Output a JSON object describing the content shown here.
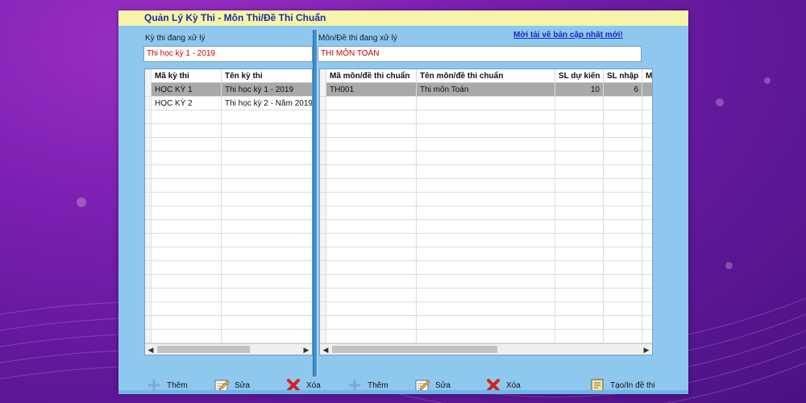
{
  "window": {
    "title": "Quản Lý Kỳ Thi - Môn Thi/Đề Thi Chuẩn"
  },
  "left": {
    "label": "Kỳ thi đang xử lý",
    "value": "Thi học kỳ 1 - 2019",
    "columns": [
      "Mã kỳ thi",
      "Tên kỳ thi"
    ],
    "rows": [
      [
        "HỌC KỲ 1",
        "Thi học kỳ 1 - 2019"
      ],
      [
        "HỌC KỲ 2",
        "Thi học kỳ 2 - Năm 2019"
      ]
    ],
    "selected_row": 0
  },
  "right": {
    "label": "Môn/Đề thi đang xử lý",
    "value": "THI MÔN TOÁN",
    "update_link": "Mời tải về bản cập nhật mới!",
    "columns": [
      "Mã môn/đề thi chuẩn",
      "Tên môn/đề thi chuẩn",
      "SL dự kiến",
      "SL nhập",
      "M"
    ],
    "rows": [
      [
        "TH001",
        "Thi môn Toán",
        "10",
        "6",
        ""
      ]
    ],
    "selected_row": 0
  },
  "toolbar": {
    "add_label": "Thêm",
    "edit_label": "Sửa",
    "delete_label": "Xóa",
    "add2_label": "Thêm",
    "edit2_label": "Sửa",
    "delete2_label": "Xóa",
    "create_label": "Tạo/In đề thi"
  },
  "colors": {
    "window_bg": "#8ec8ef",
    "title_bg": "#f7f3a8",
    "title_text": "#1d2fa0",
    "field_text": "#d00000",
    "link": "#1428c8",
    "selected_row": "#a9a9a9"
  },
  "icons": [
    "plus-icon",
    "pencil-notepad-icon",
    "red-x-icon",
    "document-print-icon"
  ]
}
